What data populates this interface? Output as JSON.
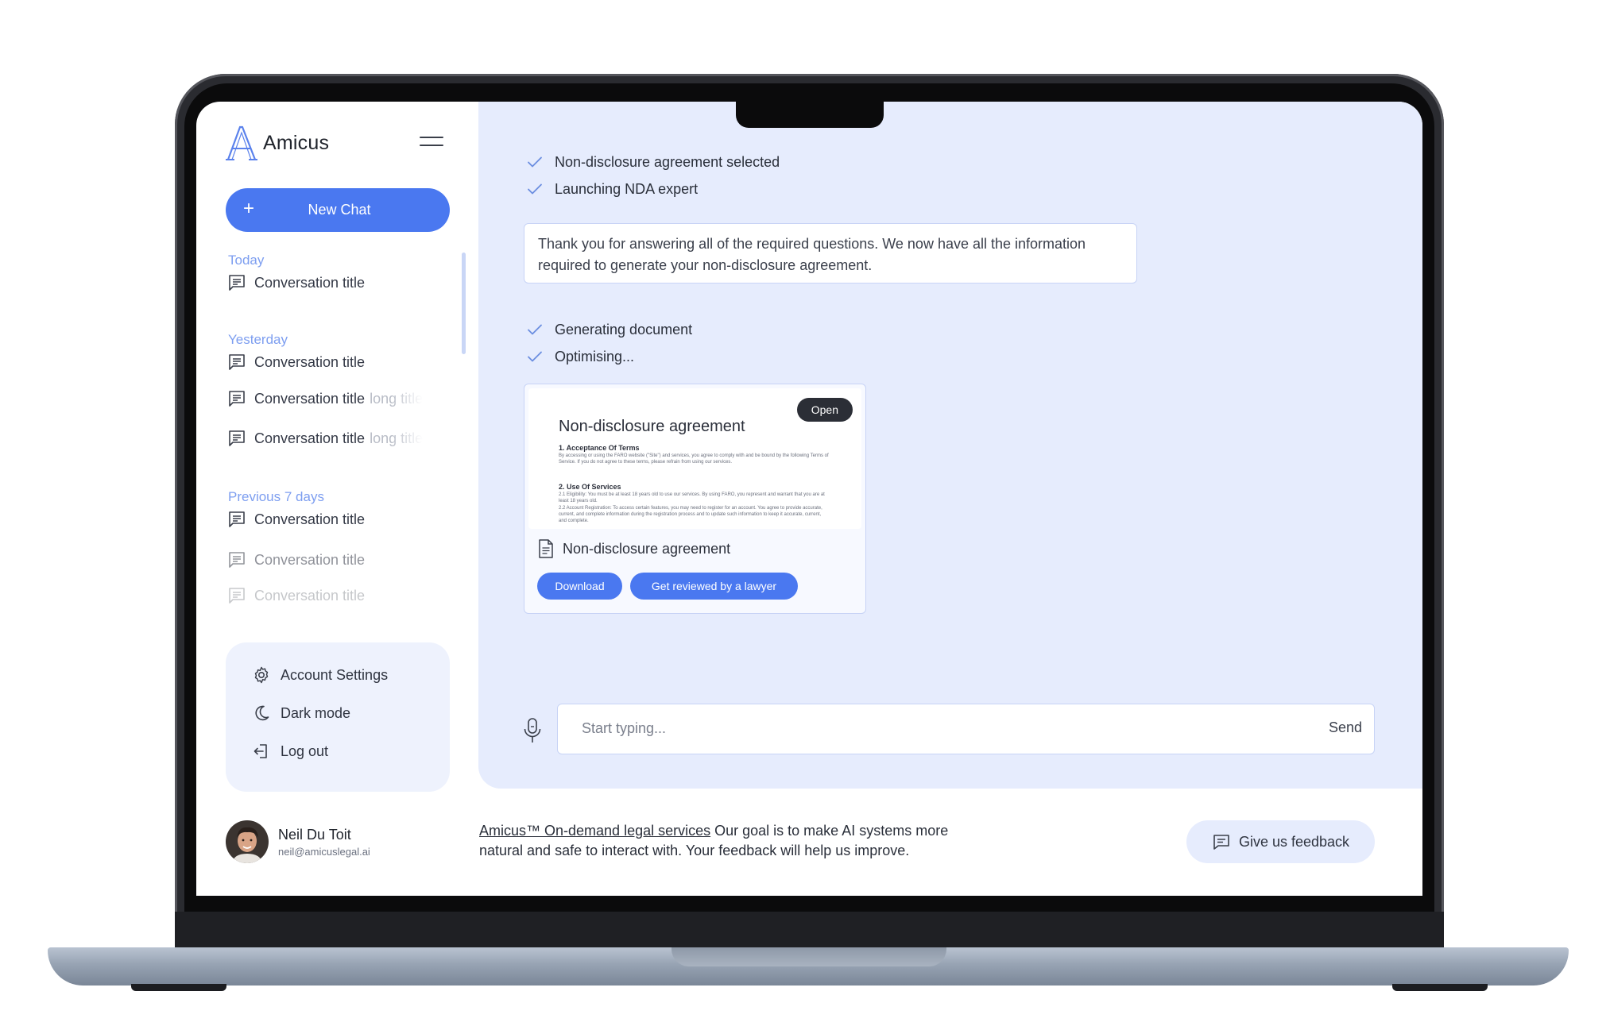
{
  "app": {
    "name": "Amicus"
  },
  "sidebar": {
    "new_chat_label": "New Chat",
    "new_chat_icon": "+",
    "sections": [
      {
        "label": "Today",
        "items": [
          {
            "title": "Conversation title",
            "overflow": ""
          }
        ]
      },
      {
        "label": "Yesterday",
        "items": [
          {
            "title": "Conversation title",
            "overflow": ""
          },
          {
            "title": "Conversation title",
            "overflow": "long title"
          },
          {
            "title": "Conversation title",
            "overflow": "long title"
          }
        ]
      },
      {
        "label": "Previous 7 days",
        "items": [
          {
            "title": "Conversation title",
            "overflow": ""
          },
          {
            "title": "Conversation title",
            "overflow": ""
          },
          {
            "title": "Conversation title",
            "overflow": ""
          }
        ]
      }
    ],
    "settings": [
      {
        "label": "Account Settings",
        "icon": "gear-icon"
      },
      {
        "label": "Dark mode",
        "icon": "moon-icon"
      },
      {
        "label": "Log out",
        "icon": "logout-icon"
      }
    ],
    "user": {
      "name": "Neil Du Toit",
      "email": "neil@amicuslegal.ai"
    }
  },
  "chat": {
    "status_top": [
      "Non-disclosure agreement selected",
      "Launching NDA expert"
    ],
    "message": "Thank you for answering all of the required questions. We now have all the information required to generate your non-disclosure agreement.",
    "status_bottom": [
      "Generating document",
      "Optimising..."
    ],
    "document": {
      "preview_title": "Non-disclosure agreement",
      "open_label": "Open",
      "section1_title": "1. Acceptance Of Terms",
      "section1_text": "By accessing or using the FARO website (\"Site\") and services, you agree to comply with and be bound by the following Terms of Service. If you do not agree to these terms, please refrain from using our services.",
      "section2_title": "2. Use Of Services",
      "section2_text_1": "2.1 Eligibility: You must be at least 18 years old to use our services. By using FARO, you represent and warrant that you are at least 18 years old.",
      "section2_text_2": "2.2 Account Registration: To access certain features, you may need to register for an account. You agree to provide accurate, current, and complete information during the registration process and to update such information to keep it accurate, current, and complete.",
      "name": "Non-disclosure agreement",
      "download_label": "Download",
      "review_label": "Get reviewed by a lawyer"
    },
    "input": {
      "placeholder": "Start typing...",
      "value": "",
      "send_label": "Send"
    }
  },
  "footer": {
    "link_text": "Amicus™ On-demand legal services",
    "text": " Our goal is to make AI systems more natural and safe to interact with. Your feedback will help us improve.",
    "feedback_label": "Give us feedback"
  },
  "colors": {
    "accent": "#4a78f0",
    "main_bg": "#e6ecfd",
    "section_label": "#7d9ef0",
    "check": "#6b8de0"
  }
}
